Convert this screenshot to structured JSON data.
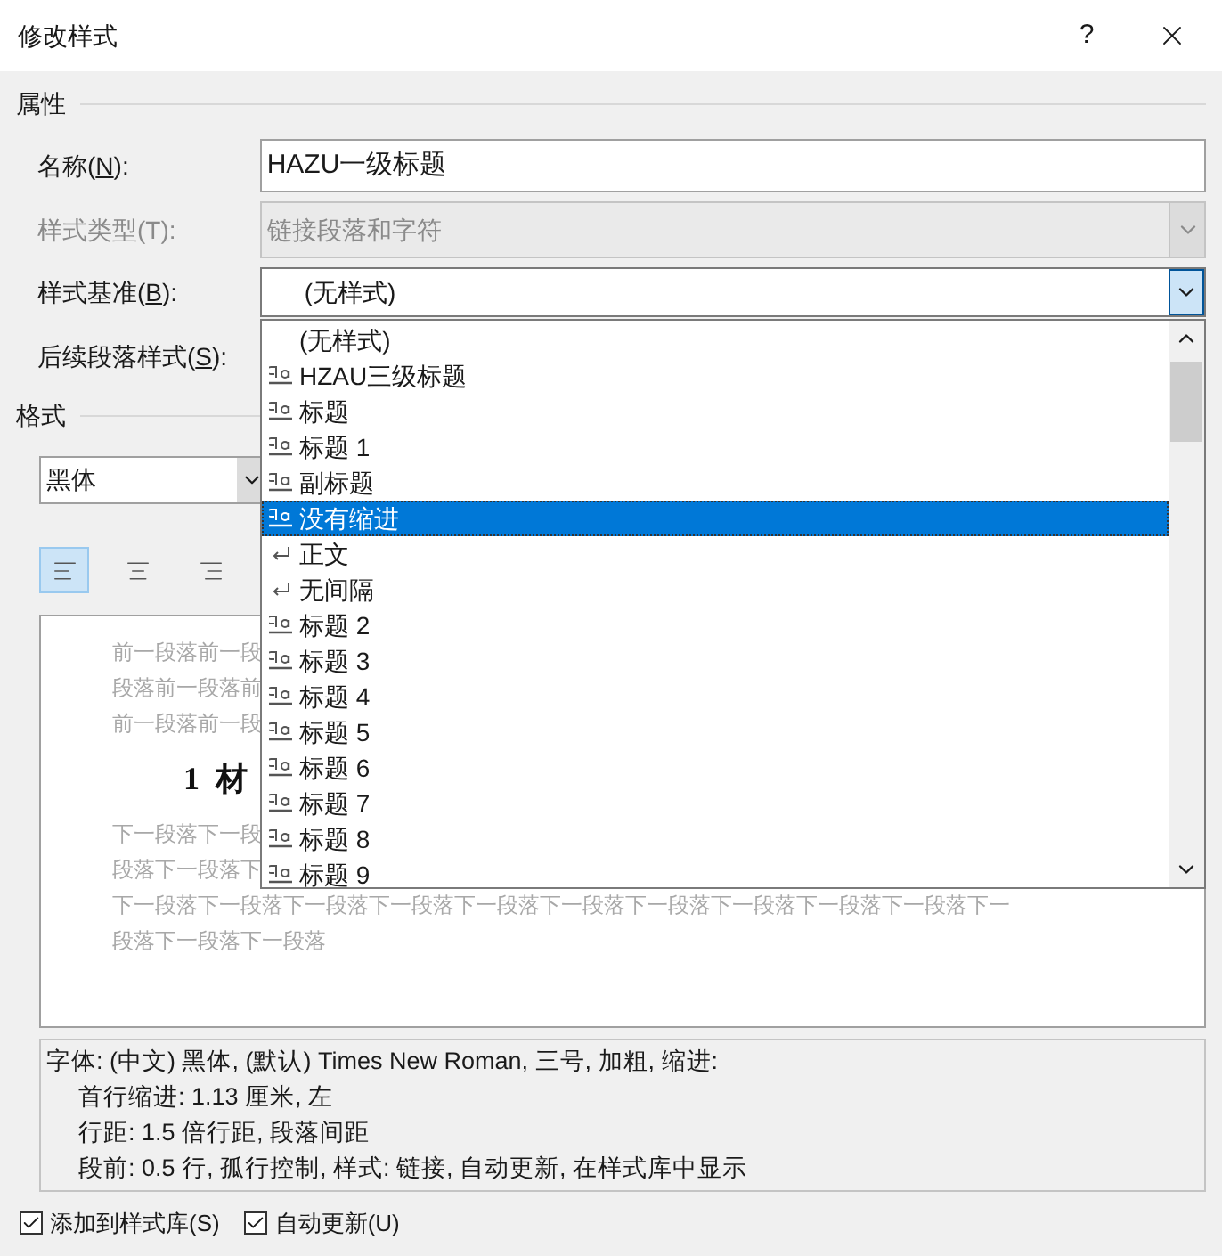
{
  "window": {
    "title": "修改样式",
    "help": "?"
  },
  "properties": {
    "heading": "属性",
    "name": {
      "label": "名称(",
      "mnemonic": "N",
      "label_end": "):",
      "value": "HAZU一级标题"
    },
    "style_type": {
      "label": "样式类型(T):",
      "value": "链接段落和字符",
      "disabled": true
    },
    "based_on": {
      "label": "样式基准(",
      "mnemonic": "B",
      "label_end": "):",
      "value": "(无样式)",
      "expanded": true
    },
    "next_style": {
      "label": "后续段落样式(",
      "mnemonic": "S",
      "label_end": "):"
    }
  },
  "dropdown_items": [
    {
      "label": "(无样式)",
      "kind": "none",
      "selected": false
    },
    {
      "label": "HZAU三级标题",
      "kind": "linked",
      "selected": false
    },
    {
      "label": "标题",
      "kind": "linked",
      "selected": false
    },
    {
      "label": "标题 1",
      "kind": "linked",
      "selected": false
    },
    {
      "label": "副标题",
      "kind": "linked",
      "selected": false
    },
    {
      "label": "没有缩进",
      "kind": "linked",
      "selected": true
    },
    {
      "label": "正文",
      "kind": "paragraph",
      "selected": false
    },
    {
      "label": "无间隔",
      "kind": "paragraph",
      "selected": false
    },
    {
      "label": "标题 2",
      "kind": "linked",
      "selected": false
    },
    {
      "label": "标题 3",
      "kind": "linked",
      "selected": false
    },
    {
      "label": "标题 4",
      "kind": "linked",
      "selected": false
    },
    {
      "label": "标题 5",
      "kind": "linked",
      "selected": false
    },
    {
      "label": "标题 6",
      "kind": "linked",
      "selected": false
    },
    {
      "label": "标题 7",
      "kind": "linked",
      "selected": false
    },
    {
      "label": "标题 8",
      "kind": "linked",
      "selected": false
    },
    {
      "label": "标题 9",
      "kind": "linked",
      "selected": false
    }
  ],
  "format": {
    "heading": "格式",
    "font": "黑体",
    "alignment": [
      {
        "kind": "left",
        "selected": true
      },
      {
        "kind": "center",
        "selected": false
      },
      {
        "kind": "right",
        "selected": false
      }
    ]
  },
  "preview": {
    "before": [
      "前一段落前一段",
      "段落前一段落前",
      "前一段落前一段"
    ],
    "heading": "1  材",
    "after_partial": [
      "下一段落下一段",
      "段落下一段落下"
    ],
    "after": [
      "下一段落下一段落下一段落下一段落下一段落下一段落下一段落下一段落下一段落下一段落下一",
      "段落下一段落下一段落"
    ]
  },
  "description": [
    "字体: (中文) 黑体, (默认) Times New Roman, 三号, 加粗, 缩进:",
    "首行缩进:  1.13 厘米, 左",
    "行距: 1.5 倍行距, 段落间距",
    "段前: 0.5 行, 孤行控制, 样式: 链接, 自动更新, 在样式库中显示"
  ],
  "options": [
    {
      "label": "添加到样式库(S)",
      "checked": true
    },
    {
      "label": "自动更新(U)",
      "checked": true
    }
  ]
}
